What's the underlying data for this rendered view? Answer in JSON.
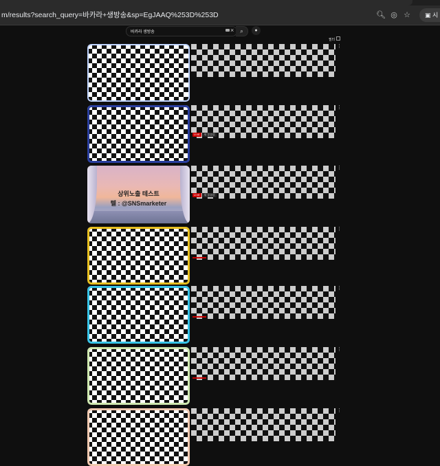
{
  "browser": {
    "url": "m/results?search_query=바카라+생방송&sp=EgJAAQ%253D%253D",
    "profile_label": "시"
  },
  "search": {
    "query": "바카라 생방송",
    "filter_label": "필터"
  },
  "results": [
    {
      "badge": "",
      "new": ""
    },
    {
      "badge": "LIVE",
      "new": "새 동영상"
    },
    {
      "badge": "LIVE",
      "new": "새 동영상",
      "thumb_title": "상위노출 테스트",
      "thumb_sub": "텔 : @SNSmarketer"
    },
    {
      "badge": "",
      "new": ""
    },
    {
      "badge": "",
      "new": ""
    },
    {
      "badge": "",
      "new": ""
    },
    {
      "badge": "",
      "new": ""
    }
  ],
  "colors": {
    "background": "#0f0f0f",
    "live_red": "#cc0000"
  }
}
